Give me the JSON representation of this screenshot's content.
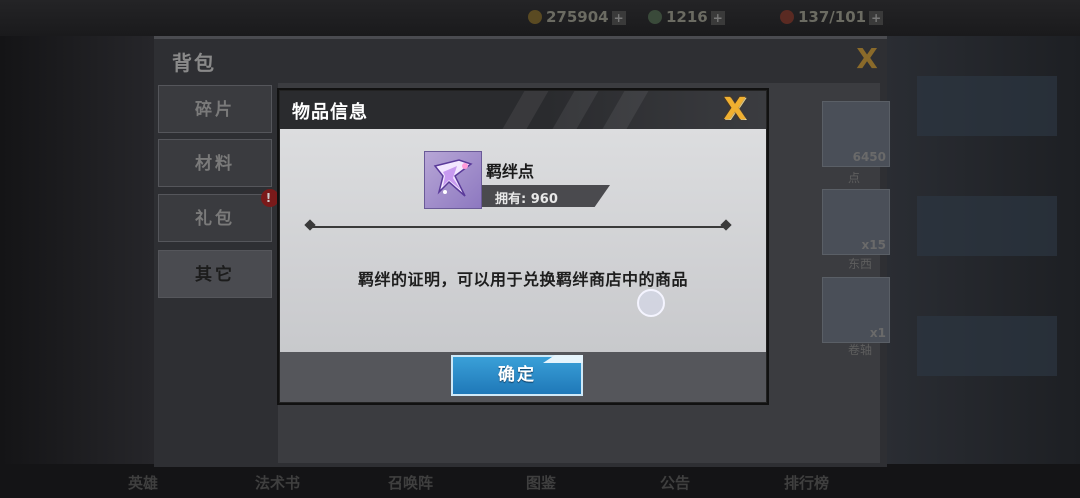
{
  "background": {
    "currencies": [
      {
        "name": "coin-icon",
        "value": "275904"
      },
      {
        "name": "gem-icon",
        "value": "1216"
      },
      {
        "name": "stamina-icon",
        "value": "137/101"
      }
    ],
    "bottom_nav": [
      "英雄",
      "法术书",
      "召唤阵",
      "图鉴",
      "公告",
      "排行榜"
    ]
  },
  "backpack": {
    "title": "背包",
    "close_label": "X",
    "tabs": [
      {
        "label": "碎片",
        "active": false
      },
      {
        "label": "材料",
        "active": false
      },
      {
        "label": "礼包",
        "active": false,
        "badge": "!"
      },
      {
        "label": "其它",
        "active": true
      }
    ],
    "slots": [
      {
        "count": "6450",
        "label": "点"
      },
      {
        "count": "x15",
        "label": "东西"
      },
      {
        "count": "x1",
        "label": "卷轴"
      }
    ]
  },
  "item_info": {
    "title": "物品信息",
    "close_label": "X",
    "item_name": "羁绊点",
    "owned_text": "拥有: 960",
    "description": "羁绊的证明，可以用于兑换羁绊商店中的商品",
    "confirm_label": "确定"
  },
  "colors": {
    "modal_header": "#2a2b2e",
    "close_gold": "#f0b030",
    "confirm_blue": "#2a8ccb",
    "icon_purple": "#a48fcc"
  }
}
